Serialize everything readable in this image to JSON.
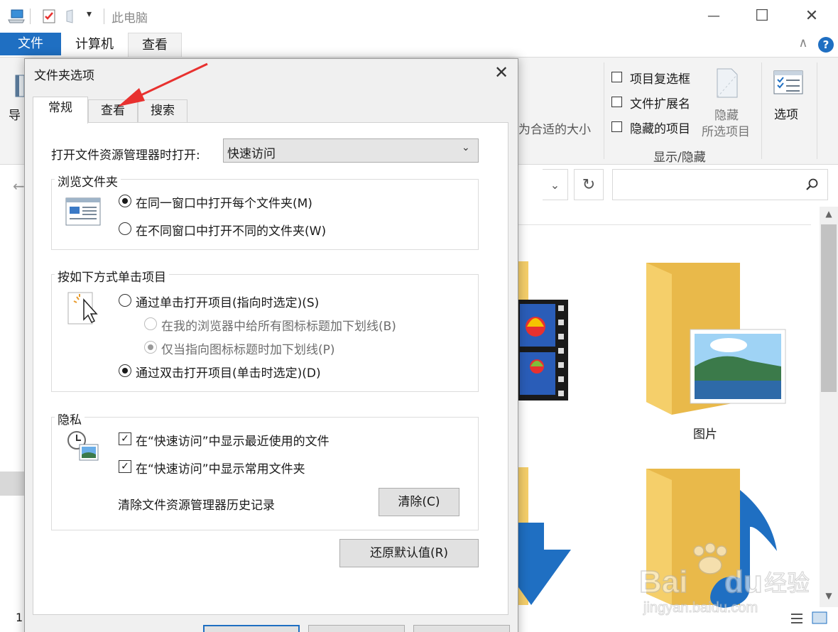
{
  "window": {
    "title": "此电脑",
    "controls": {
      "minimize": "—",
      "maximize": "☐",
      "close": "✕"
    }
  },
  "ribbon": {
    "tabs": [
      "文件",
      "计算机",
      "查看"
    ],
    "collapse_glyph": "∧",
    "help_glyph": "?",
    "nav_partial": "导",
    "fit_columns_partial": "为合适的大小",
    "show_hide": {
      "checkboxes": [
        "项目复选框",
        "文件扩展名",
        "隐藏的项目"
      ],
      "hide_selected_line1": "隐藏",
      "hide_selected_line2": "所选项目",
      "group_label": "显示/隐藏"
    },
    "options_label": "选项"
  },
  "nav": {
    "back_glyph": "←",
    "dropdown_glyph": "⌄",
    "refresh_glyph": "↻"
  },
  "content": {
    "folders": [
      {
        "name": "图片",
        "icon": "pictures-folder-icon"
      },
      {
        "name": "",
        "icon": "videos-folder-icon"
      },
      {
        "name": "",
        "icon": "downloads-folder-icon"
      },
      {
        "name": "",
        "icon": "music-folder-icon"
      }
    ],
    "status_count_partial": "1",
    "scroll_up": "▲",
    "scroll_down": "▼"
  },
  "dialog": {
    "title": "文件夹选项",
    "close_glyph": "✕",
    "tabs": [
      "常规",
      "查看",
      "搜索"
    ],
    "open_with_label": "打开文件资源管理器时打开:",
    "open_with_value": "快速访问",
    "combo_arrow": "⌄",
    "browse": {
      "title": "浏览文件夹",
      "options": [
        "在同一窗口中打开每个文件夹(M)",
        "在不同窗口中打开不同的文件夹(W)"
      ],
      "selected": 0
    },
    "click": {
      "title": "按如下方式单击项目",
      "single": "通过单击打开项目(指向时选定)(S)",
      "underline_all": "在我的浏览器中给所有图标标题加下划线(B)",
      "underline_hover": "仅当指向图标标题时加下划线(P)",
      "double": "通过双击打开项目(单击时选定)(D)"
    },
    "privacy": {
      "title": "隐私",
      "recent_files": "在“快速访问”中显示最近使用的文件",
      "frequent_folders": "在“快速访问”中显示常用文件夹",
      "clear_label": "清除文件资源管理器历史记录",
      "clear_button": "清除(C)"
    },
    "restore_button": "还原默认值(R)",
    "check_glyph": "✓"
  },
  "colors": {
    "accent": "#1f6fc2",
    "arrow_annotation": "#e8312f",
    "folder": "#f5cf6a"
  }
}
